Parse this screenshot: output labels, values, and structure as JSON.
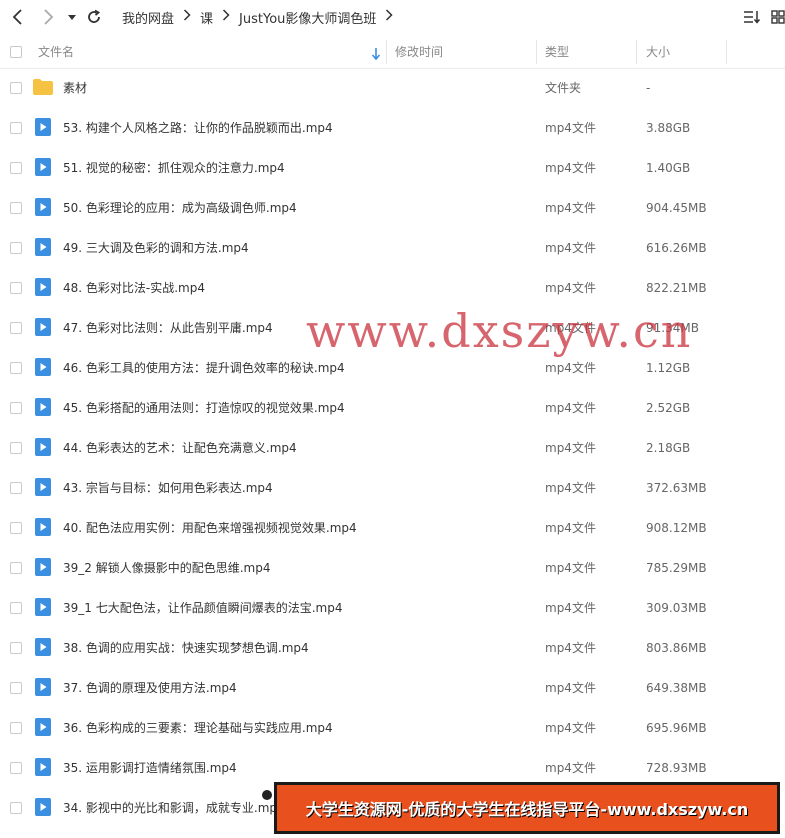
{
  "toolbar": {
    "back_icon": "chevron-left-icon",
    "forward_icon": "chevron-right-icon",
    "dropdown_icon": "caret-down-icon",
    "refresh_icon": "refresh-icon",
    "breadcrumbs": [
      "我的网盘",
      "课",
      "JustYou影像大师调色班"
    ]
  },
  "header": {
    "name": "文件名",
    "modified": "修改时间",
    "type": "类型",
    "size": "大小",
    "sort_icon": "sort-down-arrow-icon"
  },
  "colors": {
    "folder": "#f5c341",
    "video_icon": "#3b8fe0",
    "watermark": "#c8323c",
    "banner_bg": "#e8501e"
  },
  "rows": [
    {
      "name": "素材",
      "type": "文件夹",
      "size": "-",
      "icon": "folder-icon"
    },
    {
      "name": "53. 构建个人风格之路：让你的作品脱颖而出.mp4",
      "type": "mp4文件",
      "size": "3.88GB",
      "icon": "video-file-icon"
    },
    {
      "name": "51. 视觉的秘密：抓住观众的注意力.mp4",
      "type": "mp4文件",
      "size": "1.40GB",
      "icon": "video-file-icon"
    },
    {
      "name": "50. 色彩理论的应用：成为高级调色师.mp4",
      "type": "mp4文件",
      "size": "904.45MB",
      "icon": "video-file-icon"
    },
    {
      "name": "49. 三大调及色彩的调和方法.mp4",
      "type": "mp4文件",
      "size": "616.26MB",
      "icon": "video-file-icon"
    },
    {
      "name": "48. 色彩对比法-实战.mp4",
      "type": "mp4文件",
      "size": "822.21MB",
      "icon": "video-file-icon"
    },
    {
      "name": "47. 色彩对比法则：从此告别平庸.mp4",
      "type": "mp4文件",
      "size": "91.34MB",
      "icon": "video-file-icon"
    },
    {
      "name": "46. 色彩工具的使用方法：提升调色效率的秘诀.mp4",
      "type": "mp4文件",
      "size": "1.12GB",
      "icon": "video-file-icon"
    },
    {
      "name": "45. 色彩搭配的通用法则：打造惊叹的视觉效果.mp4",
      "type": "mp4文件",
      "size": "2.52GB",
      "icon": "video-file-icon"
    },
    {
      "name": "44. 色彩表达的艺术：让配色充满意义.mp4",
      "type": "mp4文件",
      "size": "2.18GB",
      "icon": "video-file-icon"
    },
    {
      "name": "43. 宗旨与目标：如何用色彩表达.mp4",
      "type": "mp4文件",
      "size": "372.63MB",
      "icon": "video-file-icon"
    },
    {
      "name": "40. 配色法应用实例：用配色来增强视频视觉效果.mp4",
      "type": "mp4文件",
      "size": "908.12MB",
      "icon": "video-file-icon"
    },
    {
      "name": "39_2 解锁人像摄影中的配色思维.mp4",
      "type": "mp4文件",
      "size": "785.29MB",
      "icon": "video-file-icon"
    },
    {
      "name": "39_1 七大配色法，让作品颜值瞬间爆表的法宝.mp4",
      "type": "mp4文件",
      "size": "309.03MB",
      "icon": "video-file-icon"
    },
    {
      "name": "38. 色调的应用实战：快速实现梦想色调.mp4",
      "type": "mp4文件",
      "size": "803.86MB",
      "icon": "video-file-icon"
    },
    {
      "name": "37. 色调的原理及使用方法.mp4",
      "type": "mp4文件",
      "size": "649.38MB",
      "icon": "video-file-icon"
    },
    {
      "name": "36. 色彩构成的三要素：理论基础与实践应用.mp4",
      "type": "mp4文件",
      "size": "695.96MB",
      "icon": "video-file-icon"
    },
    {
      "name": "35. 运用影调打造情绪氛围.mp4",
      "type": "mp4文件",
      "size": "728.93MB",
      "icon": "video-file-icon"
    },
    {
      "name": "34. 影视中的光比和影调，成就专业.mp4",
      "type": "mp4文件",
      "size": "",
      "icon": "video-file-icon"
    }
  ],
  "watermark": "www.dxszyw.cn",
  "banner": "大学生资源网-优质的大学生在线指导平台-www.dxszyw.cn"
}
